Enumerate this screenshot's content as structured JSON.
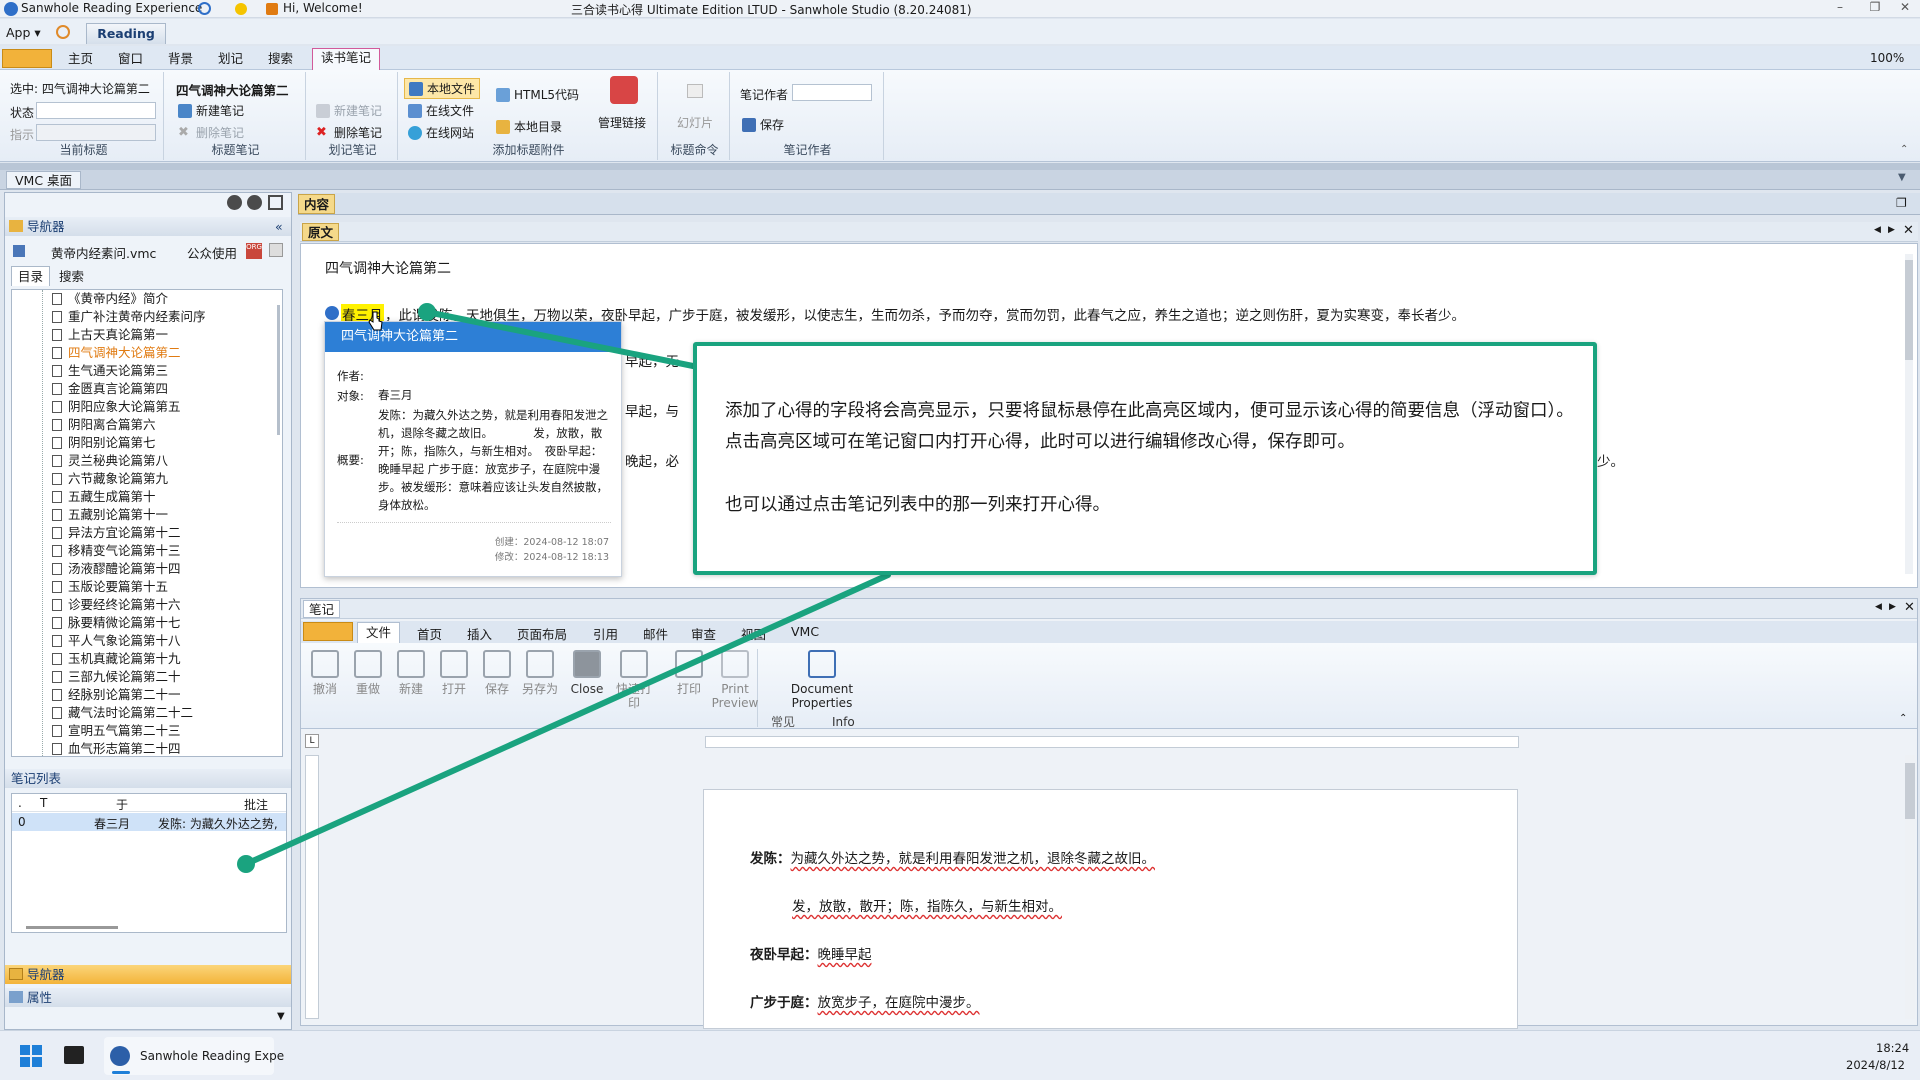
{
  "window": {
    "app_name": "Sanwhole Reading Experience",
    "welcome": "Hi, Welcome!",
    "title": "三合读书心得 Ultimate Edition LTUD - Sanwhole Studio (8.20.24081)"
  },
  "menu": {
    "app_label": "App",
    "reading_tab": "Reading"
  },
  "ribbon_tabs": [
    "主页",
    "窗口",
    "背景",
    "划记",
    "搜索",
    "读书笔记"
  ],
  "zoom": "100%",
  "ribbon": {
    "current_title": {
      "selected": "选中: 四气调神大论篇第二",
      "status_label": "状态",
      "hint_label": "指示",
      "group": "当前标题"
    },
    "title_notes": {
      "title": "四气调神大论篇第二",
      "new_note": "新建笔记",
      "delete_note": "删除笔记",
      "group": "标题笔记"
    },
    "mark_notes": {
      "new_note": "新建笔记",
      "delete_note": "删除笔记",
      "group": "划记笔记"
    },
    "attachments": {
      "local_file": "本地文件",
      "online_file": "在线文件",
      "online_site": "在线网站",
      "html5_code": "HTML5代码",
      "local_dir": "本地目录",
      "manage_links": "管理链接",
      "group": "添加标题附件"
    },
    "title_cmd": {
      "slideshow": "幻灯片",
      "group": "标题命令"
    },
    "author": {
      "label": "笔记作者",
      "save": "保存",
      "group": "笔记作者"
    }
  },
  "vmc_desktop": "VMC 桌面",
  "left": {
    "navigator": "导航器",
    "file": "黄帝内经素问.vmc",
    "public_use": "公众使用",
    "tabs": [
      "目录",
      "搜索"
    ],
    "tree": [
      "《黄帝内经》简介",
      "重广补注黄帝内经素问序",
      "上古天真论篇第一",
      "四气调神大论篇第二",
      "生气通天论篇第三",
      "金匮真言论篇第四",
      "阴阳应象大论篇第五",
      "阴阳离合篇第六",
      "阴阳别论篇第七",
      "灵兰秘典论篇第八",
      "六节藏象论篇第九",
      "五藏生成篇第十",
      "五藏别论篇第十一",
      "异法方宜论篇第十二",
      "移精变气论篇第十三",
      "汤液醪醴论篇第十四",
      "玉版论要篇第十五",
      "诊要经终论篇第十六",
      "脉要精微论篇第十七",
      "平人气象论篇第十八",
      "玉机真藏论篇第十九",
      "三部九候论篇第二十",
      "经脉别论篇第二十一",
      "藏气法时论篇第二十二",
      "宣明五气篇第二十三",
      "血气形志篇第二十四"
    ],
    "notes_list": {
      "title": "笔记列表",
      "headers": [
        ".",
        "T",
        "",
        "于",
        "批注"
      ],
      "rows": [
        [
          "0",
          "",
          "",
          "春三月",
          "发陈: 为藏久外达之势,"
        ]
      ]
    },
    "bottom_nav": "导航器",
    "bottom_props": "属性"
  },
  "content": {
    "tab": "内容",
    "original_tab": "原文",
    "doc_title": "四气调神大论篇第二",
    "highlight": "春三月",
    "line1_rest": "，此谓发陈，天地俱生，万物以荣，夜卧早起，广步于庭，被发缓形，以使志生，生而勿杀，予而勿夺，赏而勿罚，此春气之应，养生之道也；逆之则伤肝，夏为实寒变，奉长者少。",
    "frag_l2": "早起，无",
    "frag_l3": "早起，与",
    "frag_l4": "晚起，必",
    "frag_l4_end": "少。"
  },
  "popup": {
    "title": "四气调神大论篇第二",
    "author_label": "作者:",
    "target_label": "对象:",
    "target_value": "春三月",
    "summary_label": "概要:",
    "summary": "发陈：为藏久外达之势，就是利用春阳发泄之机，退除冬藏之故旧。　　　　发，放散，散开；陈，指陈久，与新生相对。　夜卧早起：晚睡早起 广步于庭：放宽步子，在庭院中漫步。被发缓形：意味着应该让头发自然披散，身体放松。",
    "created": "创建：2024-08-12 18:07",
    "modified": "修改：2024-08-12 18:13"
  },
  "callout": {
    "para1": "添加了心得的字段将会高亮显示，只要将鼠标悬停在此高亮区域内，便可显示该心得的简要信息（浮动窗口）。点击高亮区域可在笔记窗口内打开心得，此时可以进行编辑修改心得，保存即可。",
    "para2": "也可以通过点击笔记列表中的那一列来打开心得。"
  },
  "notes": {
    "tab": "笔记",
    "word_tabs": [
      "文件",
      "首页",
      "插入",
      "页面布局",
      "引用",
      "邮件",
      "审查",
      "视图",
      "VMC"
    ],
    "buttons": [
      "撤消",
      "重做",
      "新建",
      "打开",
      "保存",
      "另存为",
      "Close",
      "快速打印",
      "打印",
      "Print Preview",
      "Document Properties"
    ],
    "group_common": "常见",
    "group_info": "Info",
    "page_lines": [
      {
        "bold": "发陈：",
        "text": "为藏久外达之势，就是利用春阳发泄之机，退除冬藏之故旧。"
      },
      {
        "bold": "",
        "text": "发，放散，散开；陈，指陈久，与新生相对。"
      },
      {
        "bold": "夜卧早起：",
        "text": "晚睡早起"
      },
      {
        "bold": "广步于庭：",
        "text": "放宽步子，在庭院中漫步。"
      }
    ]
  },
  "taskbar": {
    "app": "Sanwhole Reading Expe",
    "time": "18:24",
    "date": "2024/8/12"
  },
  "colors": {
    "accent": "#1aa37f",
    "popup_header": "#2d7fd6",
    "highlight": "#fff200",
    "selected_tree": "#e07b12"
  }
}
